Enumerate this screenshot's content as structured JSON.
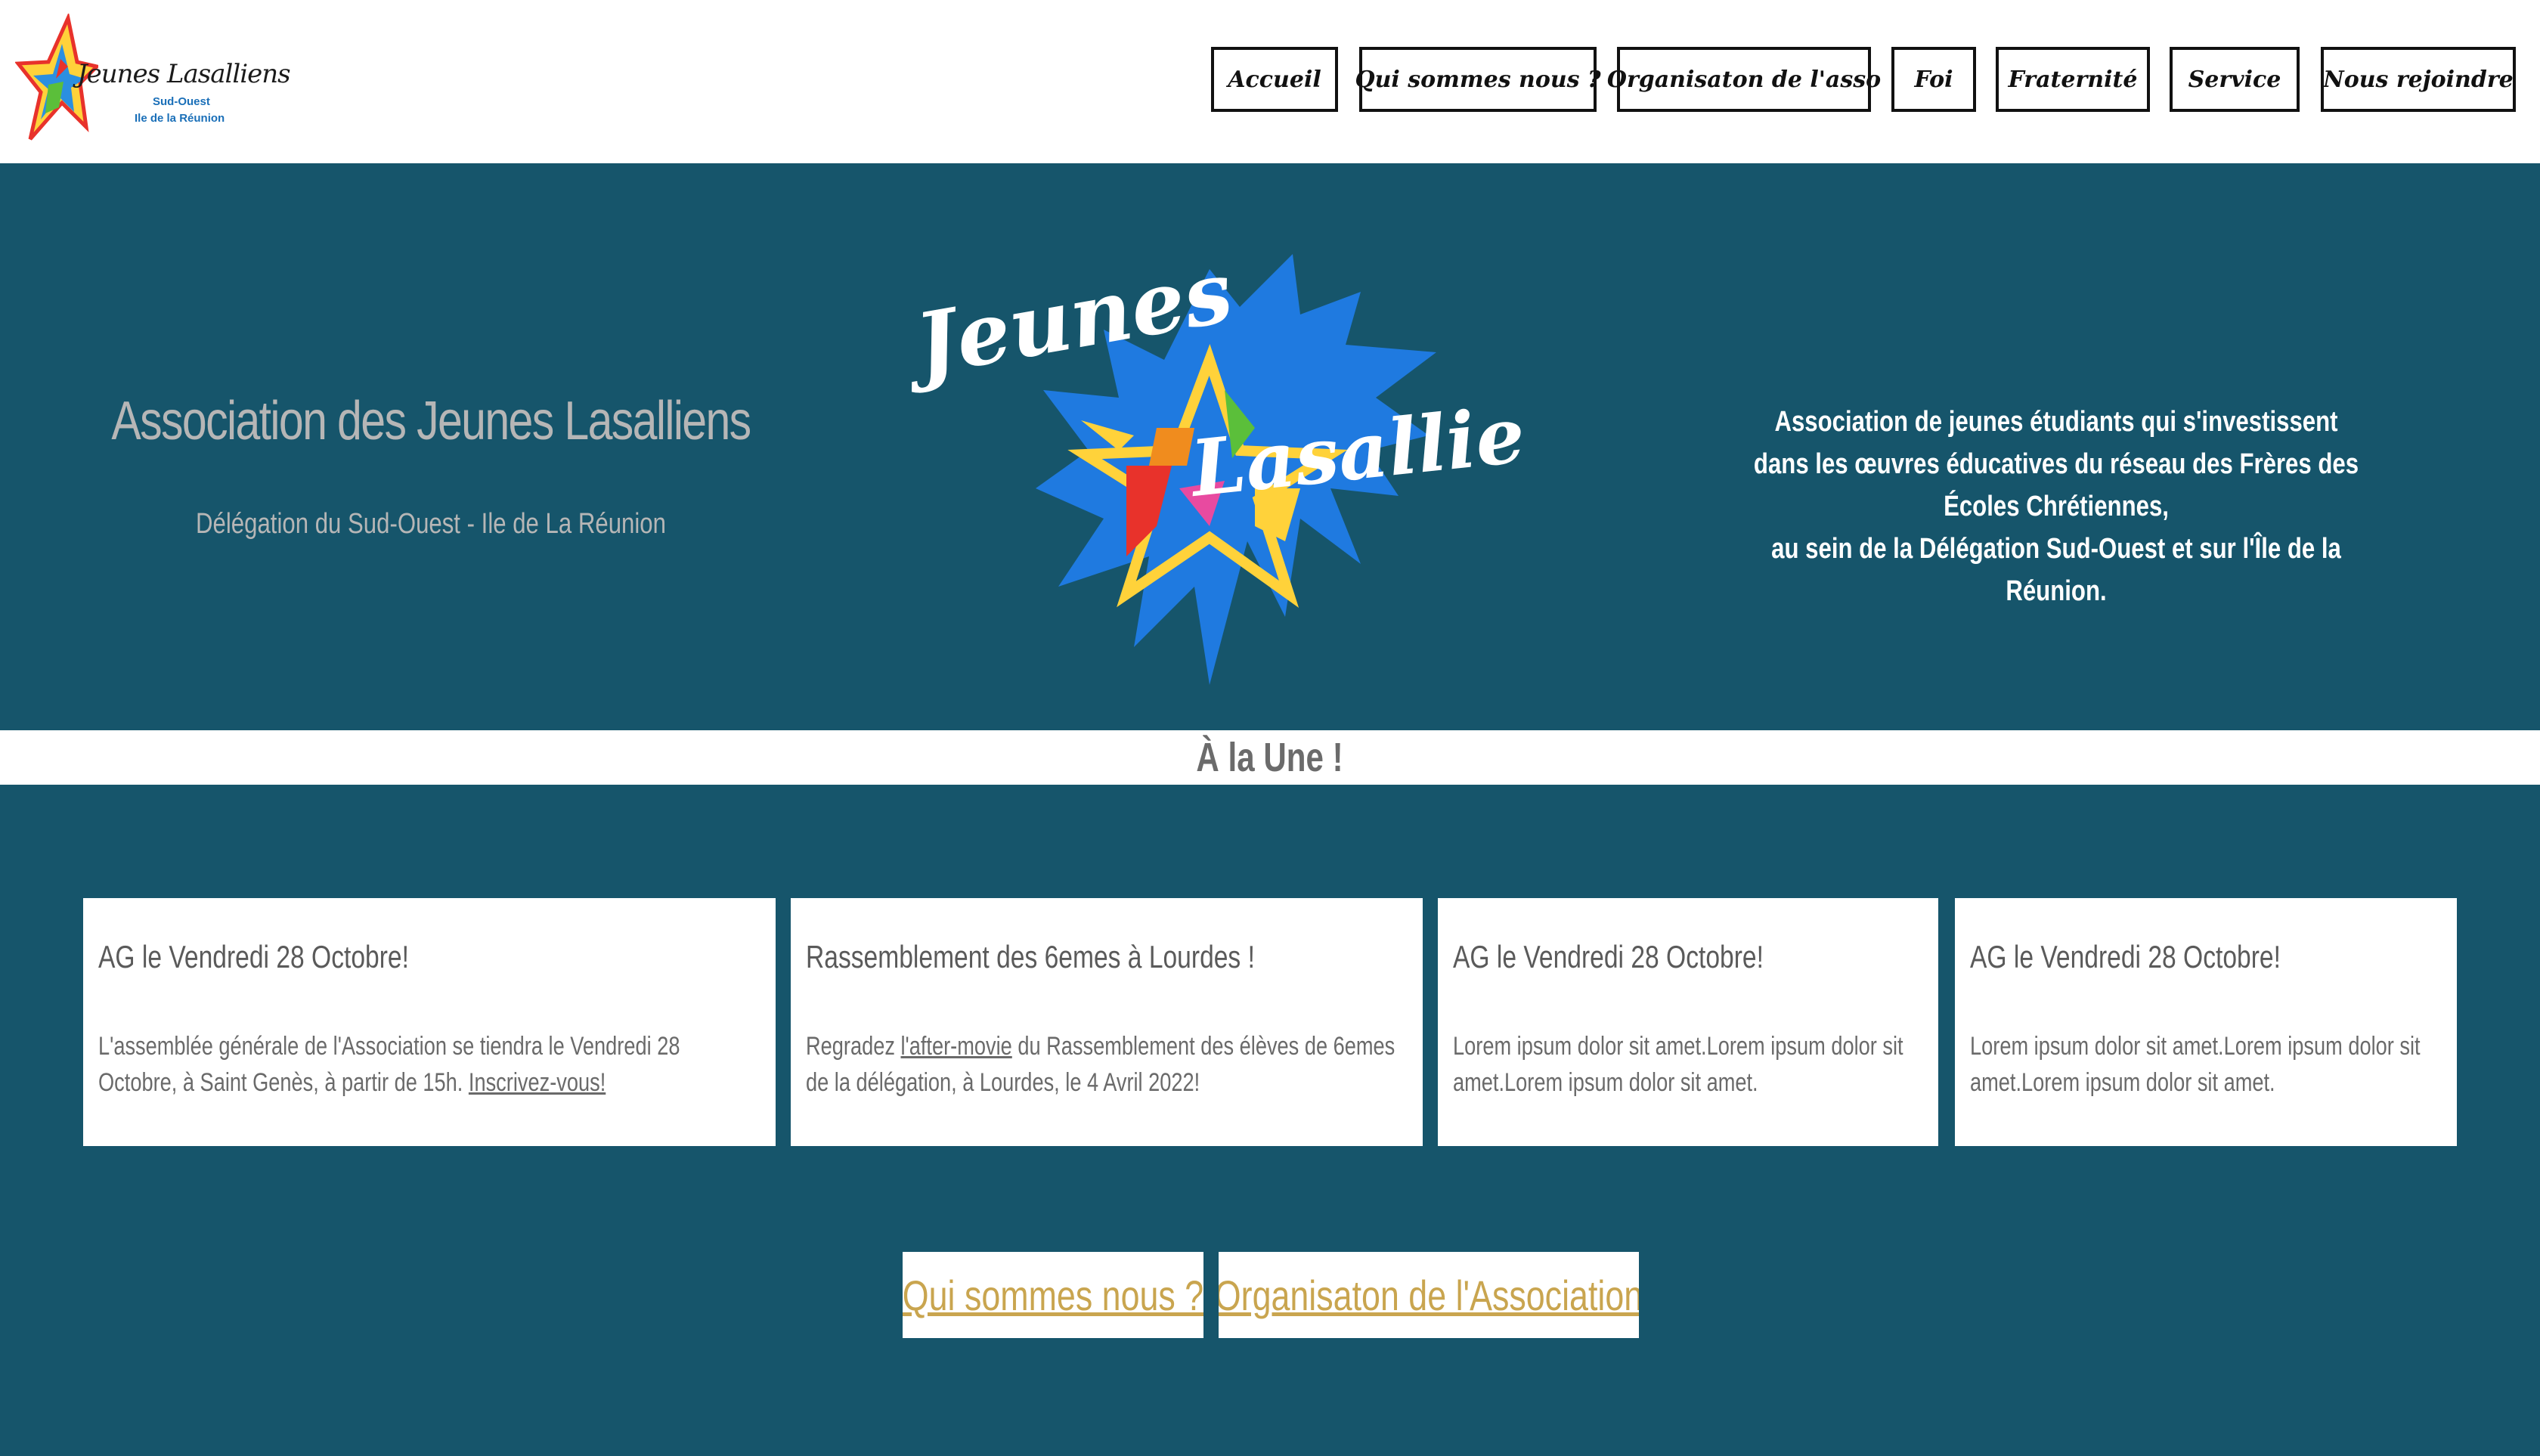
{
  "header": {
    "logo": {
      "title": "Jeunes Lasalliens",
      "line1": "Sud-Ouest",
      "line2": "Ile de la Réunion"
    },
    "nav": [
      {
        "label": "Accueil"
      },
      {
        "label": "Qui sommes nous ?"
      },
      {
        "label": "Organisaton de l'asso"
      },
      {
        "label": "Foi"
      },
      {
        "label": "Fraternité"
      },
      {
        "label": "Service"
      },
      {
        "label": "Nous rejoindre"
      }
    ]
  },
  "hero": {
    "title": "Association des Jeunes Lasalliens",
    "subtitle": "Délégation du Sud-Ouest - Ile de La Réunion",
    "logo_word1": "Jeunes",
    "logo_word2": "Lasalliens",
    "description": [
      "Association de jeunes étudiants qui s'investissent",
      "dans les œuvres éducatives du réseau des Frères des Écoles Chrétiennes,",
      "au sein de la Délégation Sud-Ouest et sur l'Île de la Réunion."
    ]
  },
  "section_title": "À la Une !",
  "cards": [
    {
      "title": "AG le Vendredi 28 Octobre!",
      "body_before": "L'assemblée générale de l'Association se tiendra le Vendredi 28 Octobre, à Saint Genès, à partir de 15h. ",
      "link": "Inscrivez-vous!",
      "body_after": ""
    },
    {
      "title": "Rassemblement des 6emes à Lourdes !",
      "body_before": "Regradez ",
      "link": "l'after-movie",
      "body_after": " du Rassemblement des élèves de 6emes de la délégation, à Lourdes, le 4 Avril 2022!"
    },
    {
      "title": "AG le Vendredi 28 Octobre!",
      "body_before": "Lorem ipsum dolor sit amet.Lorem ipsum dolor sit amet.Lorem ipsum dolor sit amet.",
      "link": "",
      "body_after": ""
    },
    {
      "title": "AG le Vendredi 28 Octobre!",
      "body_before": "Lorem ipsum dolor sit amet.Lorem ipsum dolor sit amet.Lorem ipsum dolor sit amet.",
      "link": "",
      "body_after": ""
    }
  ],
  "buttons": {
    "about": "Qui sommes nous ?",
    "organisation": "Organisaton de l'Association"
  },
  "colors": {
    "primary": "#16556b",
    "accent": "#c9a54f",
    "star_blue": "#1f7ae0"
  }
}
